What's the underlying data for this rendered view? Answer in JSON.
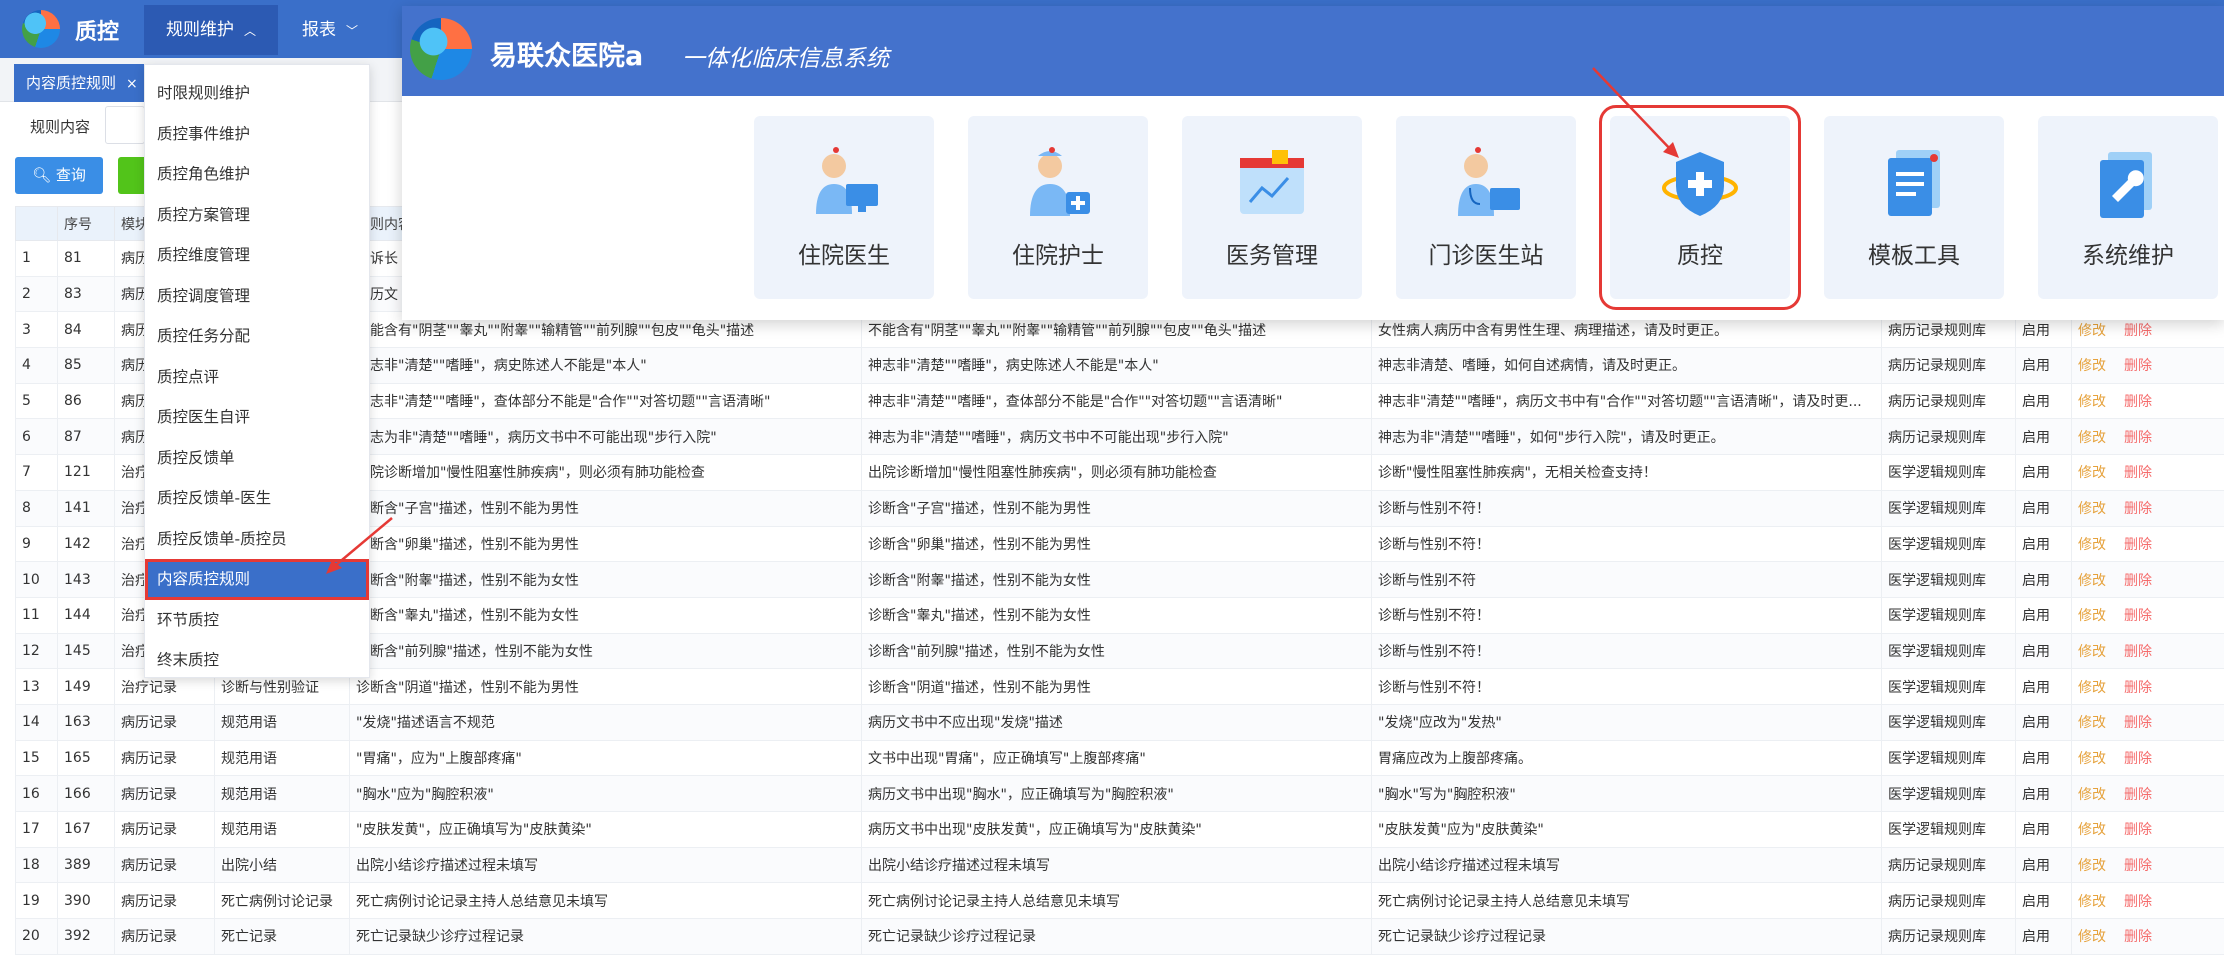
{
  "header": {
    "brand": "质控",
    "menus": [
      {
        "label": "规则维护",
        "chevron": "chevron-up-icon"
      },
      {
        "label": "报表",
        "chevron": "chevron-down-icon"
      }
    ]
  },
  "tabs": [
    {
      "label": "内容质控规则",
      "close": "×"
    }
  ],
  "filter": {
    "label": "规则内容",
    "query_button": "查询"
  },
  "table": {
    "columns": [
      "",
      "序号",
      "模块",
      "",
      "规则内容",
      "",
      "",
      "",
      "",
      ""
    ],
    "rows": [
      [
        "1",
        "81",
        "病历",
        "",
        "主诉长",
        "",
        "",
        "",
        "",
        ""
      ],
      [
        "2",
        "83",
        "病历",
        "",
        "病历文",
        "",
        "",
        "",
        "",
        ""
      ],
      [
        "3",
        "84",
        "病历",
        "",
        "不能含有\"阴茎\"\"睾丸\"\"附睾\"\"输精管\"\"前列腺\"\"包皮\"\"龟头\"描述",
        "不能含有\"阴茎\"\"睾丸\"\"附睾\"\"输精管\"\"前列腺\"\"包皮\"\"龟头\"描述",
        "女性病人病历中含有男性生理、病理描述，请及时更正。",
        "病历记录规则库",
        "启用"
      ],
      [
        "4",
        "85",
        "病历",
        "",
        "神志非\"清楚\"\"嗜睡\"，病史陈述人不能是\"本人\"",
        "神志非\"清楚\"\"嗜睡\"，病史陈述人不能是\"本人\"",
        "神志非清楚、嗜睡，如何自述病情，请及时更正。",
        "病历记录规则库",
        "启用"
      ],
      [
        "5",
        "86",
        "病历",
        "",
        "神志非\"清楚\"\"嗜睡\"，查体部分不能是\"合作\"\"对答切题\"\"言语清晰\"",
        "神志非\"清楚\"\"嗜睡\"，查体部分不能是\"合作\"\"对答切题\"\"言语清晰\"",
        "神志非\"清楚\"\"嗜睡\"，病历文书中有\"合作\"\"对答切题\"\"言语清晰\"，请及时更...",
        "病历记录规则库",
        "启用"
      ],
      [
        "6",
        "87",
        "病历",
        "",
        "神志为非\"清楚\"\"嗜睡\"，病历文书中不可能出现\"步行入院\"",
        "神志为非\"清楚\"\"嗜睡\"，病历文书中不可能出现\"步行入院\"",
        "神志为非\"清楚\"\"嗜睡\"，如何\"步行入院\"，请及时更正。",
        "病历记录规则库",
        "启用"
      ],
      [
        "7",
        "121",
        "治疗",
        "",
        "出院诊断增加\"慢性阻塞性肺疾病\"，则必须有肺功能检查",
        "出院诊断增加\"慢性阻塞性肺疾病\"，则必须有肺功能检查",
        "诊断\"慢性阻塞性肺疾病\"，无相关检查支持！",
        "医学逻辑规则库",
        "启用"
      ],
      [
        "8",
        "141",
        "治疗",
        "",
        "诊断含\"子宫\"描述，性别不能为男性",
        "诊断含\"子宫\"描述，性别不能为男性",
        "诊断与性别不符！",
        "医学逻辑规则库",
        "启用"
      ],
      [
        "9",
        "142",
        "治疗",
        "",
        "诊断含\"卵巢\"描述，性别不能为男性",
        "诊断含\"卵巢\"描述，性别不能为男性",
        "诊断与性别不符！",
        "医学逻辑规则库",
        "启用"
      ],
      [
        "10",
        "143",
        "治疗",
        "",
        "诊断含\"附睾\"描述，性别不能为女性",
        "诊断含\"附睾\"描述，性别不能为女性",
        "诊断与性别不符",
        "医学逻辑规则库",
        "启用"
      ],
      [
        "11",
        "144",
        "治疗",
        "",
        "诊断含\"睾丸\"描述，性别不能为女性",
        "诊断含\"睾丸\"描述，性别不能为女性",
        "诊断与性别不符！",
        "医学逻辑规则库",
        "启用"
      ],
      [
        "12",
        "145",
        "治疗",
        "",
        "诊断含\"前列腺\"描述，性别不能为女性",
        "诊断含\"前列腺\"描述，性别不能为女性",
        "诊断与性别不符！",
        "医学逻辑规则库",
        "启用"
      ],
      [
        "13",
        "149",
        "治疗记录",
        "诊断与性别验证",
        "诊断含\"阴道\"描述，性别不能为男性",
        "诊断含\"阴道\"描述，性别不能为男性",
        "诊断与性别不符！",
        "医学逻辑规则库",
        "启用"
      ],
      [
        "14",
        "163",
        "病历记录",
        "规范用语",
        "\"发烧\"描述语言不规范",
        "病历文书中不应出现\"发烧\"描述",
        "\"发烧\"应改为\"发热\"",
        "医学逻辑规则库",
        "启用"
      ],
      [
        "15",
        "165",
        "病历记录",
        "规范用语",
        "\"胃痛\"，应为\"上腹部疼痛\"",
        "文书中出现\"胃痛\"，应正确填写\"上腹部疼痛\"",
        "胃痛应改为上腹部疼痛。",
        "医学逻辑规则库",
        "启用"
      ],
      [
        "16",
        "166",
        "病历记录",
        "规范用语",
        "\"胸水\"应为\"胸腔积液\"",
        "病历文书中出现\"胸水\"，应正确填写为\"胸腔积液\"",
        "\"胸水\"写为\"胸腔积液\"",
        "医学逻辑规则库",
        "启用"
      ],
      [
        "17",
        "167",
        "病历记录",
        "规范用语",
        "\"皮肤发黄\"，应正确填写为\"皮肤黄染\"",
        "病历文书中出现\"皮肤发黄\"，应正确填写为\"皮肤黄染\"",
        "\"皮肤发黄\"应为\"皮肤黄染\"",
        "医学逻辑规则库",
        "启用"
      ],
      [
        "18",
        "389",
        "病历记录",
        "出院小结",
        "出院小结诊疗描述过程未填写",
        "出院小结诊疗描述过程未填写",
        "出院小结诊疗描述过程未填写",
        "病历记录规则库",
        "启用"
      ],
      [
        "19",
        "390",
        "病历记录",
        "死亡病例讨论记录",
        "死亡病例讨论记录主持人总结意见未填写",
        "死亡病例讨论记录主持人总结意见未填写",
        "死亡病例讨论记录主持人总结意见未填写",
        "病历记录规则库",
        "启用"
      ],
      [
        "20",
        "392",
        "病历记录",
        "死亡记录",
        "死亡记录缺少诊疗过程记录",
        "死亡记录缺少诊疗过程记录",
        "死亡记录缺少诊疗过程记录",
        "病历记录规则库",
        "启用"
      ]
    ],
    "actions": {
      "edit": "修改",
      "delete": "删除"
    }
  },
  "dropdown": {
    "items": [
      "时限规则维护",
      "质控事件维护",
      "质控角色维护",
      "质控方案管理",
      "质控维度管理",
      "质控调度管理",
      "质控任务分配",
      "质控点评",
      "质控医生自评",
      "质控反馈单",
      "质控反馈单-医生",
      "质控反馈单-质控员",
      "内容质控规则",
      "环节质控",
      "终末质控"
    ],
    "selected_index": 12
  },
  "popup": {
    "hospital": "易联众医院a",
    "subtitle": "一体化临床信息系统",
    "tiles": [
      {
        "label": "住院医生",
        "icon": "doctor-computer-icon"
      },
      {
        "label": "住院护士",
        "icon": "nurse-icon"
      },
      {
        "label": "医务管理",
        "icon": "chart-board-icon"
      },
      {
        "label": "门诊医生站",
        "icon": "doctor-stethoscope-icon"
      },
      {
        "label": "质控",
        "icon": "shield-plus-icon"
      },
      {
        "label": "模板工具",
        "icon": "document-template-icon"
      },
      {
        "label": "系统维护",
        "icon": "wrench-settings-icon"
      }
    ],
    "highlighted_tile": "质控"
  },
  "colors": {
    "header": "#3a6fc9",
    "popup_header": "#4472cc",
    "highlight": "#e53935",
    "edit": "#e6a23c",
    "delete": "#f56c6c"
  }
}
